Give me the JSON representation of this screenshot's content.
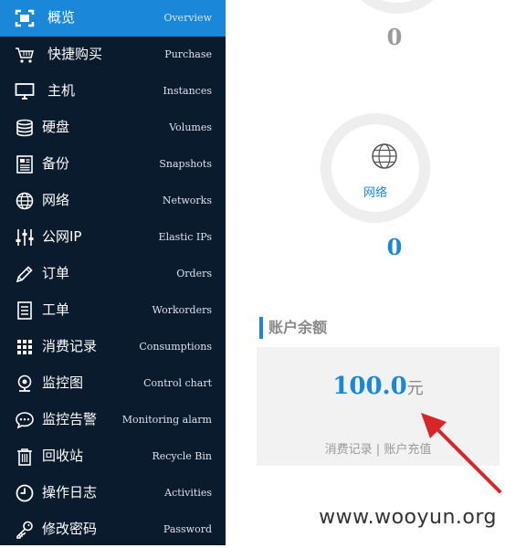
{
  "sidebar": {
    "items": [
      {
        "zh": "概览",
        "en": "Overview",
        "icon": "overview-icon",
        "active": true
      },
      {
        "zh": "快捷购买",
        "en": "Purchase",
        "icon": "cart-icon"
      },
      {
        "zh": "主机",
        "en": "Instances",
        "icon": "monitor-icon"
      },
      {
        "zh": "硬盘",
        "en": "Volumes",
        "icon": "database-icon"
      },
      {
        "zh": "备份",
        "en": "Snapshots",
        "icon": "document-icon"
      },
      {
        "zh": "网络",
        "en": "Networks",
        "icon": "globe-icon"
      },
      {
        "zh": "公网IP",
        "en": "Elastic IPs",
        "icon": "sliders-icon"
      },
      {
        "zh": "订单",
        "en": "Orders",
        "icon": "pencil-icon"
      },
      {
        "zh": "工单",
        "en": "Workorders",
        "icon": "list-doc-icon"
      },
      {
        "zh": "消费记录",
        "en": "Consumptions",
        "icon": "grid-icon"
      },
      {
        "zh": "监控图",
        "en": "Control chart",
        "icon": "webcam-icon"
      },
      {
        "zh": "监控告警",
        "en": "Monitoring alarm",
        "icon": "chat-icon"
      },
      {
        "zh": "回收站",
        "en": "Recycle Bin",
        "icon": "trash-icon"
      },
      {
        "zh": "操作日志",
        "en": "Activities",
        "icon": "clock-icon"
      },
      {
        "zh": "修改密码",
        "en": "Password",
        "icon": "key-icon"
      }
    ]
  },
  "main": {
    "top_count": "0",
    "network": {
      "label": "网络",
      "count": "0"
    },
    "balance": {
      "title": "账户余额",
      "amount": "100.0",
      "currency": "元",
      "link_consumption": "消费记录",
      "separator": "|",
      "link_recharge": "账户充值"
    },
    "watermark": "www.wooyun.org"
  },
  "colors": {
    "sidebar_bg": "#0b1b2e",
    "accent": "#1b87d8",
    "annotation_arrow": "#d9252a"
  }
}
